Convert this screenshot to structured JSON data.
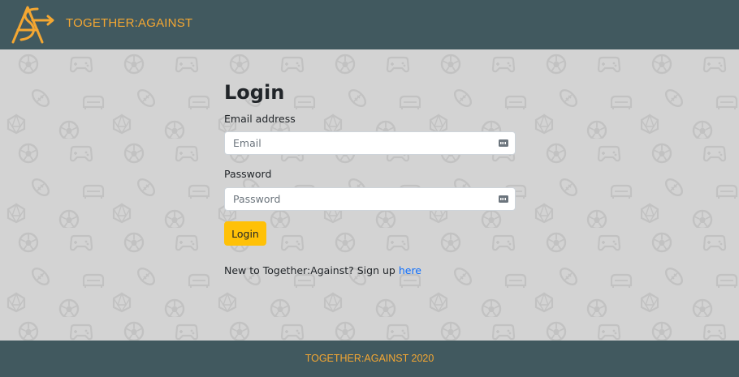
{
  "navbar": {
    "brand_text": "TOGETHER:AGAINST",
    "logo_icon": "together-against-logo",
    "background": "#41595f",
    "accent": "#f4a732"
  },
  "login": {
    "heading": "Login",
    "email_label": "Email address",
    "email_placeholder": "Email",
    "email_value": "",
    "password_label": "Password",
    "password_placeholder": "Password",
    "password_value": "",
    "field_icon": "password-manager-key-icon",
    "submit_label": "Login",
    "submit_color": "#ffc107",
    "signup_text": "New to Together:Against? Sign up ",
    "signup_link": "here",
    "link_color": "#0d6efd"
  },
  "background_pattern": {
    "icons": [
      "soccer-ball-icon",
      "game-controller-icon",
      "football-icon",
      "couch-icon",
      "d20-die-icon"
    ],
    "color": "#c4c4c4"
  },
  "footer": {
    "text": "TOGETHER:AGAINST 2020"
  }
}
